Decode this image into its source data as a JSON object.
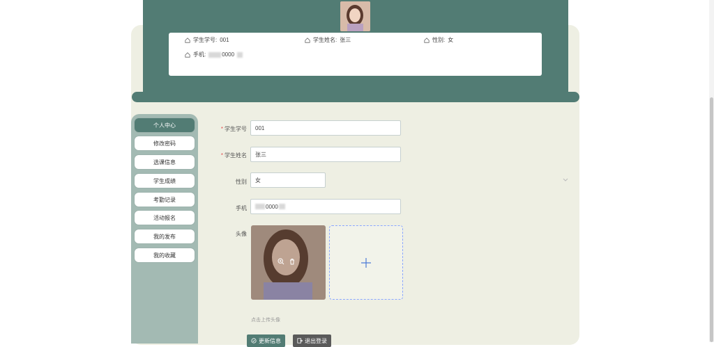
{
  "header": {
    "info": {
      "student_no_label": "学生学号:",
      "student_no_value": "001",
      "student_name_label": "学生姓名:",
      "student_name_value": "张三",
      "gender_label": "性别:",
      "gender_value": "女",
      "phone_label": "手机:",
      "phone_value_visible": "0000"
    }
  },
  "sidebar": {
    "items": [
      {
        "label": "个人中心"
      },
      {
        "label": "修改密码"
      },
      {
        "label": "选课信息"
      },
      {
        "label": "学生成绩"
      },
      {
        "label": "考勤记录"
      },
      {
        "label": "活动报名"
      },
      {
        "label": "我的发布"
      },
      {
        "label": "我的收藏"
      }
    ]
  },
  "form": {
    "student_no_label": "学生学号",
    "student_no_value": "001",
    "student_name_label": "学生姓名",
    "student_name_value": "张三",
    "gender_label": "性别",
    "gender_value": "女",
    "phone_label": "手机",
    "phone_value_visible": "0000",
    "avatar_label": "头像",
    "upload_hint": "点击上传头像",
    "update_button": "更新信息",
    "logout_button": "退出登录"
  },
  "colors": {
    "primary": "#527c74",
    "sidebar_bg": "#a3bab3",
    "panel_bg": "#eeefe3",
    "upload_border": "#8aa6ff",
    "required": "#e15151"
  }
}
